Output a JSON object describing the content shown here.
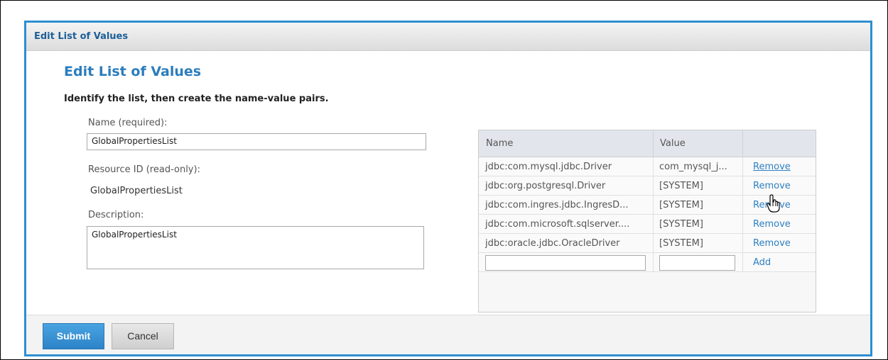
{
  "dialog": {
    "header_title": "Edit List of Values",
    "page_title": "Edit List of Values",
    "instructions": "Identify the list, then create the name-value pairs."
  },
  "form": {
    "name_label": "Name (required):",
    "name_value": "GlobalPropertiesList",
    "resource_id_label": "Resource ID (read-only):",
    "resource_id_value": "GlobalPropertiesList",
    "description_label": "Description:",
    "description_value": "GlobalPropertiesList"
  },
  "table": {
    "headers": {
      "name": "Name",
      "value": "Value"
    },
    "rows": [
      {
        "name": "jdbc:com.mysql.jdbc.Driver",
        "value": "com_mysql_j...",
        "action": "Remove"
      },
      {
        "name": "jdbc:org.postgresql.Driver",
        "value": "[SYSTEM]",
        "action": "Remove"
      },
      {
        "name": "jdbc:com.ingres.jdbc.IngresD...",
        "value": "[SYSTEM]",
        "action": "Remove"
      },
      {
        "name": "jdbc:com.microsoft.sqlserver....",
        "value": "[SYSTEM]",
        "action": "Remove"
      },
      {
        "name": "jdbc:oracle.jdbc.OracleDriver",
        "value": "[SYSTEM]",
        "action": "Remove"
      }
    ],
    "new_row": {
      "name_value": "",
      "value_value": "",
      "action": "Add"
    }
  },
  "footer": {
    "submit_label": "Submit",
    "cancel_label": "Cancel"
  },
  "colors": {
    "accent": "#2d8fd0",
    "title": "#2b7dbd",
    "link": "#2d7fc1"
  },
  "icons": {
    "cursor": "hand-pointer-icon"
  }
}
